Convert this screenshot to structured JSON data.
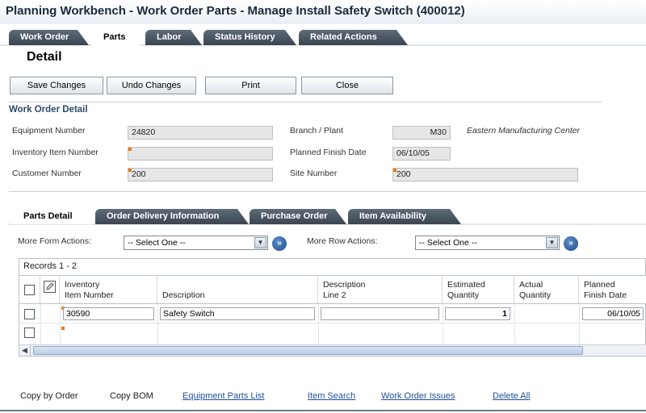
{
  "window": {
    "title": "Planning Workbench - Work Order Parts - Manage Install Safety Switch (400012)"
  },
  "main_tabs": [
    "Work Order",
    "Parts",
    "Labor",
    "Status History",
    "Related Actions"
  ],
  "page_heading": "Detail",
  "toolbar": {
    "save": "Save Changes",
    "undo": "Undo Changes",
    "print": "Print",
    "close": "Close"
  },
  "work_order_detail": {
    "title": "Work Order Detail",
    "equipment_number_label": "Equipment Number",
    "equipment_number": "24820",
    "inventory_item_label": "Inventory Item Number",
    "inventory_item": "",
    "customer_number_label": "Customer Number",
    "customer_number": "200",
    "branch_plant_label": "Branch / Plant",
    "branch_plant": "M30",
    "branch_plant_desc": "Eastern Manufacturing Center",
    "planned_finish_label": "Planned Finish Date",
    "planned_finish": "06/10/05",
    "site_number_label": "Site Number",
    "site_number": "200"
  },
  "sub_tabs": [
    "Parts Detail",
    "Order Delivery Information",
    "Purchase Order",
    "Item Availability"
  ],
  "actions": {
    "form_label": "More Form Actions:",
    "form_value": "-- Select One --",
    "row_label": "More Row Actions:",
    "row_value": "-- Select One --"
  },
  "grid": {
    "caption": "Records 1 - 2",
    "columns": [
      "Inventory\nItem Number",
      "Description",
      "Description\nLine 2",
      "Estimated\nQuantity",
      "Actual\nQuantity",
      "Planned\nFinish Date"
    ],
    "rows": [
      {
        "item": "30590",
        "description": "Safety Switch",
        "description2": "",
        "estimated_qty": "1",
        "actual_qty": "",
        "planned_finish": "06/10/05"
      },
      {
        "item": "",
        "description": "",
        "description2": "",
        "estimated_qty": "",
        "actual_qty": "",
        "planned_finish": ""
      }
    ]
  },
  "bottom_links": [
    "Copy by Order",
    "Copy BOM",
    "Equipment Parts List",
    "Item Search",
    "Work Order Issues",
    "Delete All"
  ],
  "colors": {
    "tab_dark": "#3b4552",
    "accent_link": "#1f4f9e",
    "required_marker": "#e87b1e",
    "section_title": "#2d4b6a"
  }
}
